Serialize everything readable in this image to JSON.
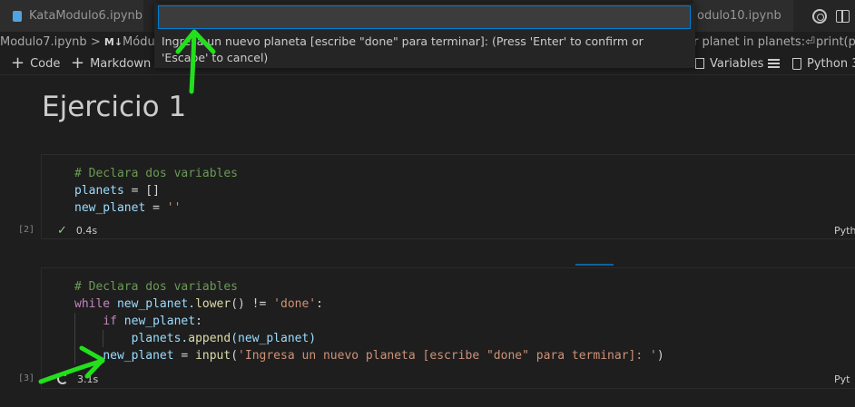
{
  "tabs": [
    {
      "label": "KataModulo6.ipynb"
    },
    {
      "label": "odulo10.ipynb"
    }
  ],
  "breadcrumb": {
    "file": "Modulo7.ipynb",
    "separator": ">",
    "md_logo": "M↓",
    "section": "Módulo",
    "right_fragment": "r planet in planets:⏎",
    "far_right": "print(pl"
  },
  "toolbar": {
    "code_label": "Code",
    "markdown_label": "Markdown",
    "variables_label": "Variables",
    "kernel_label": "Python 3."
  },
  "quick_input": {
    "value": "",
    "prompt": "Ingresa un nuevo planeta [escribe \"done\" para terminar]: (Press 'Enter' to confirm or 'Escape' to cancel)"
  },
  "notebook": {
    "heading": "Ejercicio 1",
    "cells": [
      {
        "exec_count": "[2]",
        "duration": "0.4s",
        "language": "Pyth",
        "lines": {
          "l1": "# Declara dos variables",
          "l2_var": "planets",
          "l2_op": " = ",
          "l2_val": "[]",
          "l3_var": "new_planet",
          "l3_op": " = ",
          "l3_val": "''"
        }
      },
      {
        "exec_count": "[3]",
        "duration": "3.1s",
        "language": "Pyt",
        "lines": {
          "l1": "# Declara dos variables",
          "l2_kw": "while",
          "l2_var": " new_planet.",
          "l2_fn": "lower",
          "l2_op": "() != ",
          "l2_str": "'done'",
          "l2_end": ":",
          "l3_kw": "if",
          "l3_var": " new_planet",
          "l3_end": ":",
          "l4_var": "planets.",
          "l4_fn": "append",
          "l4_rest": "(new_planet)",
          "l5_var": "new_planet",
          "l5_op": " = ",
          "l5_fn": "input",
          "l5_paren": "(",
          "l5_str": "'Ingresa un nuevo planeta [escribe \"done\" para terminar]: '",
          "l5_end": ")"
        }
      }
    ]
  },
  "colors": {
    "accent": "#007fd4",
    "annotation_green": "#22e01c",
    "background": "#1e1e1e"
  }
}
